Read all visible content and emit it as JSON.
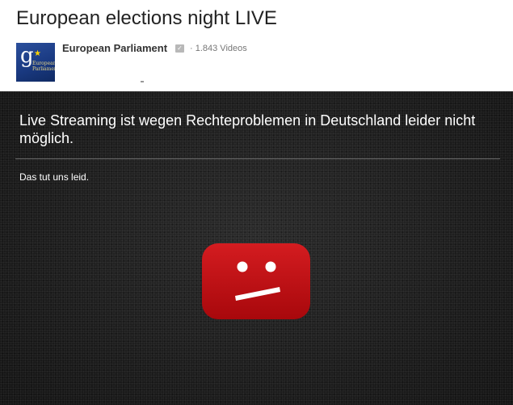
{
  "video": {
    "title": "European elections night LIVE"
  },
  "channel": {
    "name": "European Parliament",
    "video_count": "· 1.843 Videos",
    "logo": {
      "letter": "g",
      "text": "European\nParliament",
      "background_color": "#1a3a82",
      "star_color": "#ffd400"
    },
    "verified_icon": "check-badge-icon"
  },
  "player": {
    "error_message": "Live Streaming ist wegen Rechteproblemen in Deutschland leider nicht möglich.",
    "sub_message": "Das tut uns leid.",
    "icon": "sad-youtube-face-icon",
    "icon_color": "#cc181e"
  }
}
